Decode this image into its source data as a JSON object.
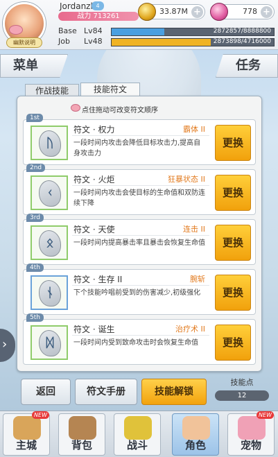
{
  "player": {
    "name": "Jordanzl",
    "level_badge": "4",
    "power": "战力 713261",
    "avatar_tag": "幽默说明"
  },
  "resources": {
    "gold": "33.87M",
    "gems": "778"
  },
  "levels": {
    "base": {
      "label": "Base",
      "lv": "Lv84",
      "xp": "2872857/8888800",
      "fraction": 0.323,
      "color": "#4a9fe0"
    },
    "job": {
      "label": "Job",
      "lv": "Lv48",
      "xp": "2873898/4716000",
      "fraction": 0.609,
      "color": "#f0b324"
    }
  },
  "banners": {
    "menu": "菜单",
    "task": "任务"
  },
  "tabs": {
    "combat_skills": "作战技能",
    "skill_runes": "技能符文"
  },
  "hint": "点住拖动可改变符文顺序",
  "runes": [
    {
      "rank": "1st",
      "name": "符文 · 权力",
      "tag": "霸体 II",
      "desc": "一段时间内攻击会降低目标攻击力,提高自身攻击力",
      "glyph": "ᚢ",
      "button": "更换"
    },
    {
      "rank": "2nd",
      "name": "符文 · 火炬",
      "tag": "狂暴状态 II",
      "desc": "一段时间内攻击会使目标的生命值和双防连续下降",
      "glyph": "ᚲ",
      "button": "更换"
    },
    {
      "rank": "3rd",
      "name": "符文 · 天使",
      "tag": "连击 II",
      "desc": "一段时间内提高暴击率且暴击会恢复生命值",
      "glyph": "ᛟ",
      "button": "更换"
    },
    {
      "rank": "4th",
      "name": "符文 · 生存 II",
      "tag": "腕斩",
      "desc": "下个技能吟唱前受到的伤害减少,初级强化",
      "glyph": "ᚾ",
      "button": "更换"
    },
    {
      "rank": "5th",
      "name": "符文 · 诞生",
      "tag": "治疗术 II",
      "desc": "一段时间内受到致命攻击时会恢复生命值",
      "glyph": "ᛞ",
      "button": "更换"
    }
  ],
  "bottom": {
    "back": "返回",
    "manual": "符文手册",
    "unlock": "技能解锁",
    "skill_points_label": "技能点",
    "skill_points": "12"
  },
  "nav": [
    {
      "label": "主城",
      "new": "NEW",
      "color": "#d9a55a"
    },
    {
      "label": "背包",
      "new": "",
      "color": "#b58552"
    },
    {
      "label": "战斗",
      "new": "",
      "color": "#e0c23a"
    },
    {
      "label": "角色",
      "new": "",
      "color": "#f1c39a"
    },
    {
      "label": "宠物",
      "new": "NEW",
      "color": "#f0a1b6"
    }
  ]
}
